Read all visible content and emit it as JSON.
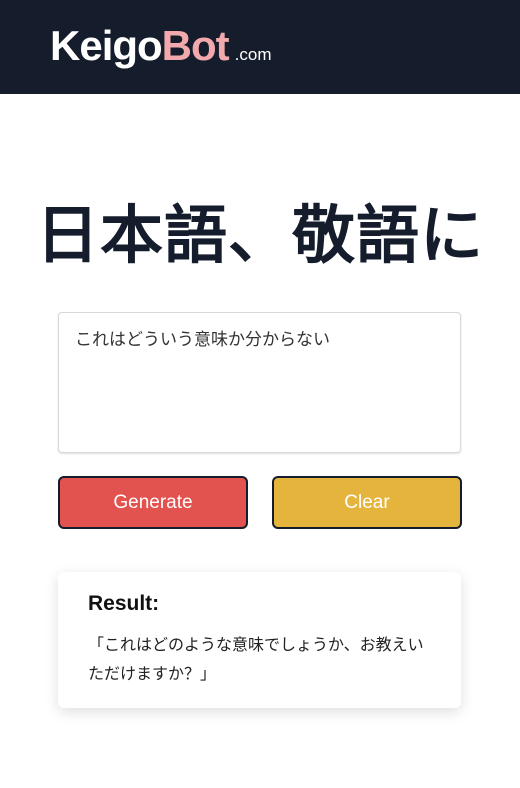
{
  "header": {
    "logo_part1": "Keigo",
    "logo_part2": "Bot",
    "logo_suffix": ".com",
    "background_color": "#151c2c",
    "accent_color": "#f2a9ab"
  },
  "main": {
    "title": "日本語、敬語に",
    "input": {
      "value": "これはどういう意味か分からない",
      "placeholder": ""
    },
    "buttons": {
      "generate_label": "Generate",
      "generate_color": "#e2524f",
      "clear_label": "Clear",
      "clear_color": "#e5b43c"
    },
    "result": {
      "label": "Result:",
      "text": "「これはどのような意味でしょうか、お教えいただけますか？」"
    }
  }
}
